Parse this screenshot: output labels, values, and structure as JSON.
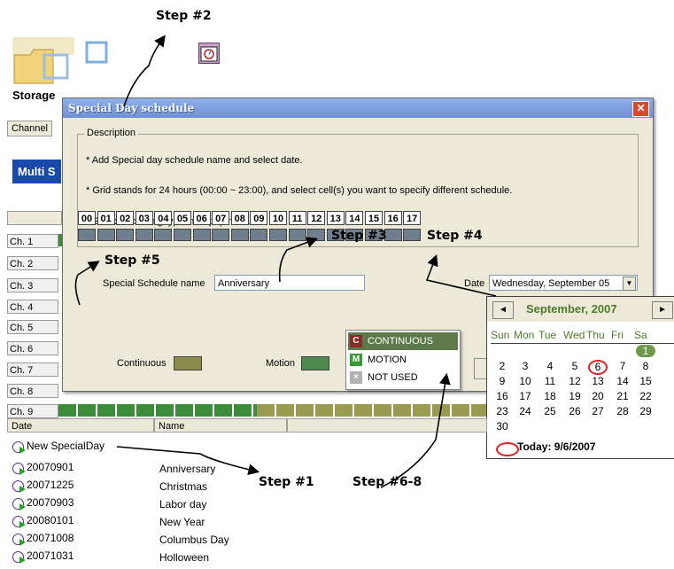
{
  "callouts": {
    "step2": "Step #2",
    "step3": "Step #3",
    "step4": "Step #4",
    "step5": "Step #5",
    "step1": "Step #1",
    "step6_8": "Step #6-8"
  },
  "background": {
    "storage_title": "Storage",
    "channel_tab": "Channel",
    "multi_button": "Multi S",
    "channels": [
      "Ch. 1",
      "Ch. 2",
      "Ch. 3",
      "Ch. 4",
      "Ch. 5",
      "Ch. 6",
      "Ch. 7",
      "Ch. 8",
      "Ch. 9"
    ]
  },
  "dialog": {
    "title": "Special Day schedule",
    "close_glyph": "✕",
    "description_legend": "Description",
    "description_lines": [
      "*  Add Special day schedule name and select date.",
      "*  Grid stands for 24 hours (00:00 ~ 23:00), and select cell(s) you want to specify different schedule.",
      "*  Select recording type in Popup menu"
    ],
    "name_label": "Special Schedule name",
    "name_value": "Anniversary",
    "date_label": "Date",
    "date_value": "Wednesday, September 05",
    "hours": [
      "00",
      "01",
      "02",
      "03",
      "04",
      "05",
      "06",
      "07",
      "08",
      "09",
      "10",
      "11",
      "12",
      "13",
      "14",
      "15",
      "16",
      "17"
    ],
    "legend_continuous": "Continuous",
    "legend_motion": "Motion",
    "colors": {
      "continuous": "#8c8c4e",
      "motion": "#4e8a4e",
      "slot": "#6f7f8f"
    }
  },
  "popup_menu": {
    "items": [
      {
        "icon": "C",
        "label": "CONTINUOUS",
        "color": "#8a2a2a"
      },
      {
        "icon": "M",
        "label": "MOTION",
        "color": "#3a9a3a"
      },
      {
        "icon": "×",
        "label": "NOT USED",
        "color": "#b0b0b0"
      }
    ]
  },
  "calendar": {
    "month": "September, 2007",
    "prev": "◄",
    "next": "►",
    "dow": [
      "Sun",
      "Mon",
      "Tue",
      "Wed",
      "Thu",
      "Fri",
      "Sa"
    ],
    "weeks": [
      [
        "",
        "",
        "",
        "",
        "",
        "",
        "1"
      ],
      [
        "2",
        "3",
        "4",
        "5",
        "6",
        "7",
        "8"
      ],
      [
        "9",
        "10",
        "11",
        "12",
        "13",
        "14",
        "15"
      ],
      [
        "16",
        "17",
        "18",
        "19",
        "20",
        "21",
        "22"
      ],
      [
        "23",
        "24",
        "25",
        "26",
        "27",
        "28",
        "29"
      ],
      [
        "30",
        "",
        "",
        "",
        "",
        "",
        ""
      ]
    ],
    "today_label": "Today: 9/6/2007"
  },
  "list": {
    "header_date": "Date",
    "header_name": "Name",
    "new_item": "New SpecialDay",
    "rows": [
      {
        "date": "20070901",
        "name": "Anniversary"
      },
      {
        "date": "20071225",
        "name": "Christmas"
      },
      {
        "date": "20070903",
        "name": "Labor day"
      },
      {
        "date": "20080101",
        "name": "New Year"
      },
      {
        "date": "20071008",
        "name": "Columbus Day"
      },
      {
        "date": "20071031",
        "name": "Holloween"
      }
    ]
  }
}
